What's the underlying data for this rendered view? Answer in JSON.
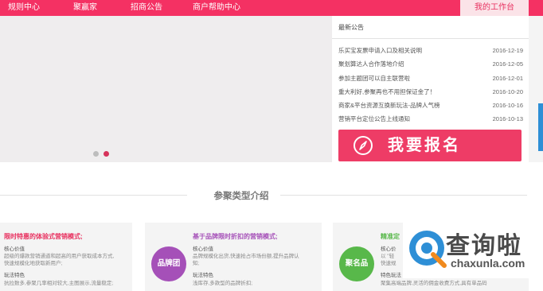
{
  "nav": {
    "items": [
      "规则中心",
      "聚赢家",
      "招商公告",
      "商户帮助中心"
    ],
    "workbench": "我的工作台"
  },
  "banner": {
    "slides_total": 2,
    "active_slide": 2
  },
  "announcements": {
    "title": "最新公告",
    "items": [
      {
        "title": "乐买宝发票申请入口及相关说明",
        "date": "2016-12-19"
      },
      {
        "title": "聚划算达人合作落地介绍",
        "date": "2016-12-05"
      },
      {
        "title": "参加主题团可以自主联营啦",
        "date": "2016-12-01"
      },
      {
        "title": "重大利好,参聚再也不用担保证金了！",
        "date": "2016-10-20"
      },
      {
        "title": "商家&平台资源互换新玩法-品牌人气榜",
        "date": "2016-10-16"
      },
      {
        "title": "营销平台定位公告上线通知",
        "date": "2016-10-13"
      }
    ]
  },
  "signup": {
    "label": "我要报名"
  },
  "section": {
    "title": "参聚类型介绍"
  },
  "cards": [
    {
      "heading": "限时特惠的体验式营销模式;",
      "lines": [
        "核心价值",
        "超级的爆款营销通道和超高的用户获取成本方式,",
        "快速规模化地获取新用户;",
        "玩法特色",
        "抗拉数多,参聚几率相对较大,主图展示,流量稳定;"
      ],
      "color": "#e8305f"
    },
    {
      "heading": "基于品牌限时折扣的营销模式;",
      "badge": "品牌团",
      "lines": [
        "核心价值",
        "品牌规模化出货,快速抢占市场份额,提升品牌认",
        "知;",
        "玩法特色",
        "浅库存,多款型的品牌折扣;"
      ],
      "color": "#a550b8"
    },
    {
      "heading": "精准定",
      "badge": "聚名品",
      "lines": [
        "核心价",
        "以 \"轻",
        "快速规",
        "特色玩法",
        "聚集高端品牌,灵活的佣金收费方式,具有单品码"
      ],
      "color": "#58b84a"
    }
  ],
  "watermark": {
    "text": "查询啦",
    "url": "chaxunla.com"
  },
  "colors": {
    "brand": "#f43163",
    "accent_blue": "#2e8fd6"
  }
}
